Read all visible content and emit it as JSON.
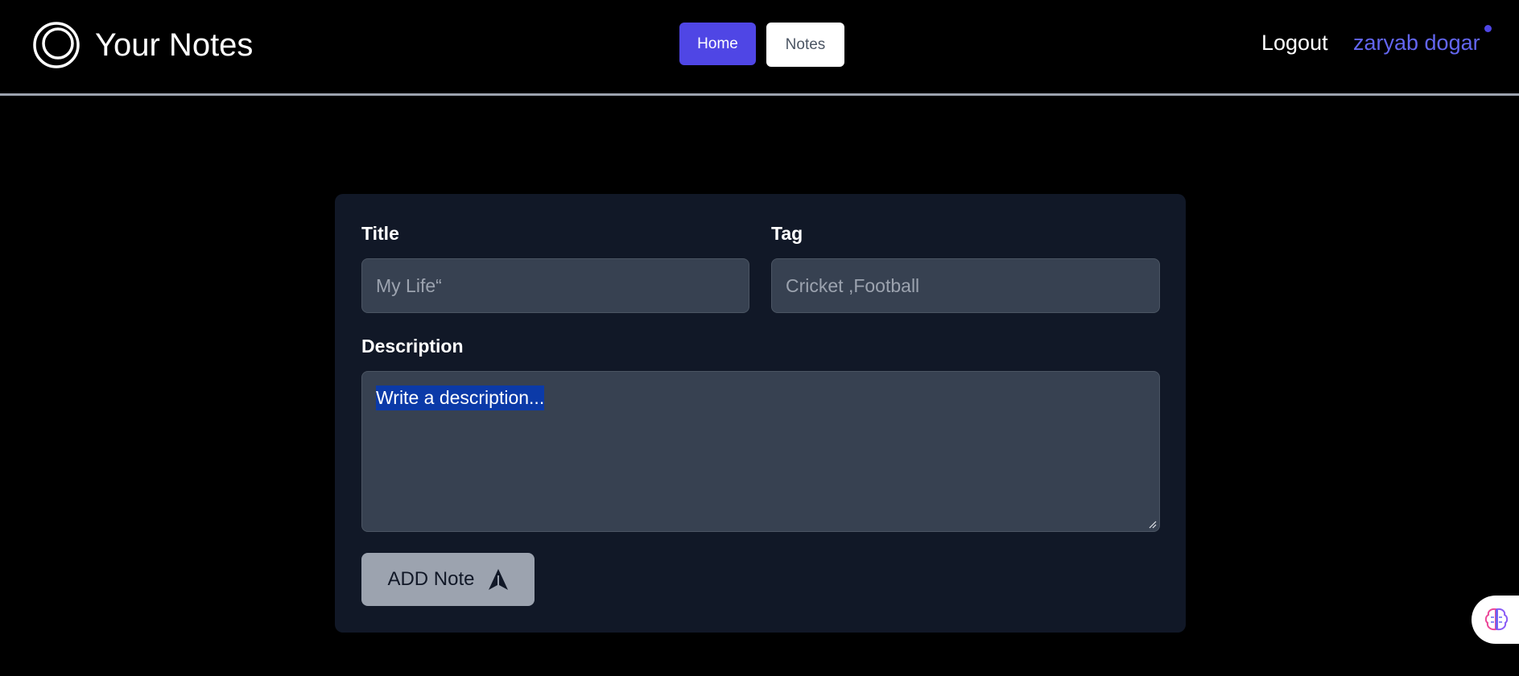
{
  "header": {
    "brand_title": "Your Notes",
    "nav": {
      "home_label": "Home",
      "notes_label": "Notes"
    },
    "logout_label": "Logout",
    "username": "zaryab dogar"
  },
  "form": {
    "title_label": "Title",
    "title_placeholder": "My Life“",
    "tag_label": "Tag",
    "tag_placeholder": "Cricket ,Football",
    "description_label": "Description",
    "description_placeholder": "Write a description...",
    "add_button_label": "ADD Note"
  },
  "icons": {
    "brand": "circle-logo-icon",
    "add": "send-arrow-icon",
    "widget": "brain-icon"
  },
  "colors": {
    "accent": "#4f46e5",
    "username": "#6366f1",
    "card_bg": "#111827",
    "field_bg": "#374151",
    "selection": "#0b3aa8"
  }
}
